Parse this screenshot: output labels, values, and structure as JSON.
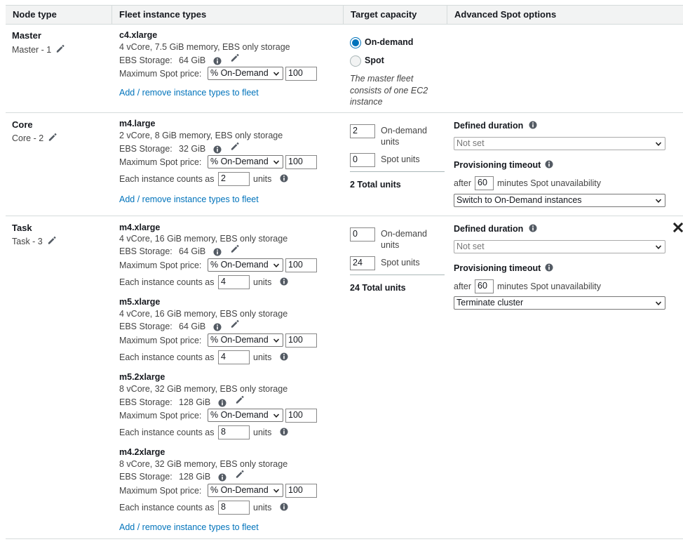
{
  "headers": {
    "node_type": "Node type",
    "fleet_instance_types": "Fleet instance types",
    "target_capacity": "Target capacity",
    "advanced_spot_options": "Advanced Spot options"
  },
  "common": {
    "ebs_storage_label": "EBS Storage:",
    "max_spot_price_label": "Maximum Spot price:",
    "spot_price_option": "% On-Demand",
    "instance_counts_label": "Each instance counts as",
    "units_label": "units",
    "add_remove_link": "Add / remove instance types to fleet",
    "on_demand_units_line1": "On-demand",
    "on_demand_units_line2": "units",
    "spot_units": "Spot units",
    "defined_duration": "Defined duration",
    "provisioning_timeout": "Provisioning timeout",
    "after_label": "after",
    "minutes_label": "minutes Spot unavailability"
  },
  "master": {
    "title": "Master",
    "name": "Master - 1",
    "instance": {
      "type": "c4.xlarge",
      "specs": "4 vCore, 7.5 GiB memory, EBS only storage",
      "ebs": "64 GiB",
      "max_price": "100"
    },
    "radio_on_demand": "On-demand",
    "radio_spot": "Spot",
    "note_line1": "The master fleet",
    "note_line2": "consists of one EC2",
    "note_line3": "instance"
  },
  "core": {
    "title": "Core",
    "name": "Core - 2",
    "instance": {
      "type": "m4.large",
      "specs": "2 vCore, 8 GiB memory, EBS only storage",
      "ebs": "32 GiB",
      "max_price": "100",
      "units": "2"
    },
    "on_demand_value": "2",
    "spot_value": "0",
    "total": "2 Total units",
    "defined_duration_value": "Not set",
    "timeout_minutes": "60",
    "timeout_action": "Switch to On-Demand instances"
  },
  "task": {
    "title": "Task",
    "name": "Task - 3",
    "instances": [
      {
        "type": "m4.xlarge",
        "specs": "4 vCore, 16 GiB memory, EBS only storage",
        "ebs": "64 GiB",
        "max_price": "100",
        "units": "4"
      },
      {
        "type": "m5.xlarge",
        "specs": "4 vCore, 16 GiB memory, EBS only storage",
        "ebs": "64 GiB",
        "max_price": "100",
        "units": "4"
      },
      {
        "type": "m5.2xlarge",
        "specs": "8 vCore, 32 GiB memory, EBS only storage",
        "ebs": "128 GiB",
        "max_price": "100",
        "units": "8"
      },
      {
        "type": "m4.2xlarge",
        "specs": "8 vCore, 32 GiB memory, EBS only storage",
        "ebs": "128 GiB",
        "max_price": "100",
        "units": "8"
      }
    ],
    "on_demand_value": "0",
    "spot_value": "24",
    "total": "24 Total units",
    "defined_duration_value": "Not set",
    "timeout_minutes": "60",
    "timeout_action": "Terminate cluster"
  },
  "icons": {
    "info": "info-icon",
    "edit": "pencil-icon",
    "remove": "close-icon",
    "dropdown": "chevron-down-icon"
  }
}
